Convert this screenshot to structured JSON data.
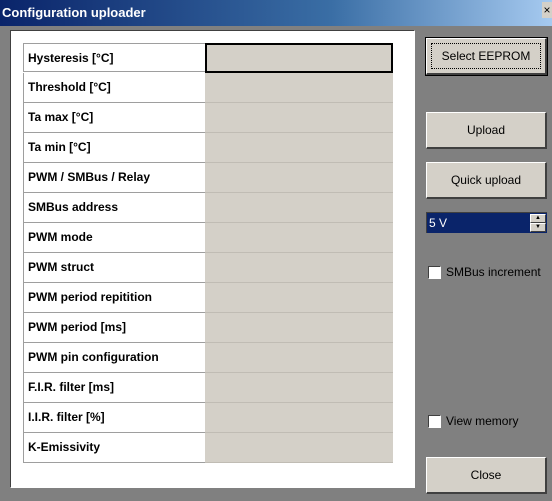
{
  "window": {
    "title": "Configuration uploader",
    "close_glyph": "×"
  },
  "table": {
    "rows": [
      {
        "label": "Hysteresis [°C]",
        "value": ""
      },
      {
        "label": "Threshold [°C]",
        "value": ""
      },
      {
        "label": "Ta max [°C]",
        "value": ""
      },
      {
        "label": "Ta min [°C]",
        "value": ""
      },
      {
        "label": "PWM / SMBus / Relay",
        "value": ""
      },
      {
        "label": "SMBus address",
        "value": ""
      },
      {
        "label": "PWM mode",
        "value": ""
      },
      {
        "label": "PWM struct",
        "value": ""
      },
      {
        "label": "PWM period repitition",
        "value": ""
      },
      {
        "label": "PWM period [ms]",
        "value": ""
      },
      {
        "label": "PWM pin configuration",
        "value": ""
      },
      {
        "label": "F.I.R. filter [ms]",
        "value": ""
      },
      {
        "label": "I.I.R. filter [%]",
        "value": ""
      },
      {
        "label": "K-Emissivity",
        "value": ""
      }
    ]
  },
  "buttons": {
    "select_eeprom": "Select EEPROM",
    "upload": "Upload",
    "quick_upload": "Quick upload",
    "close": "Close"
  },
  "voltage": {
    "selected": "5 V"
  },
  "checkboxes": {
    "smbus_increment": "SMBus increment",
    "view_memory": "View memory"
  },
  "colors": {
    "background": "#808080",
    "control": "#d4d0c8",
    "selection": "#0a246a"
  }
}
